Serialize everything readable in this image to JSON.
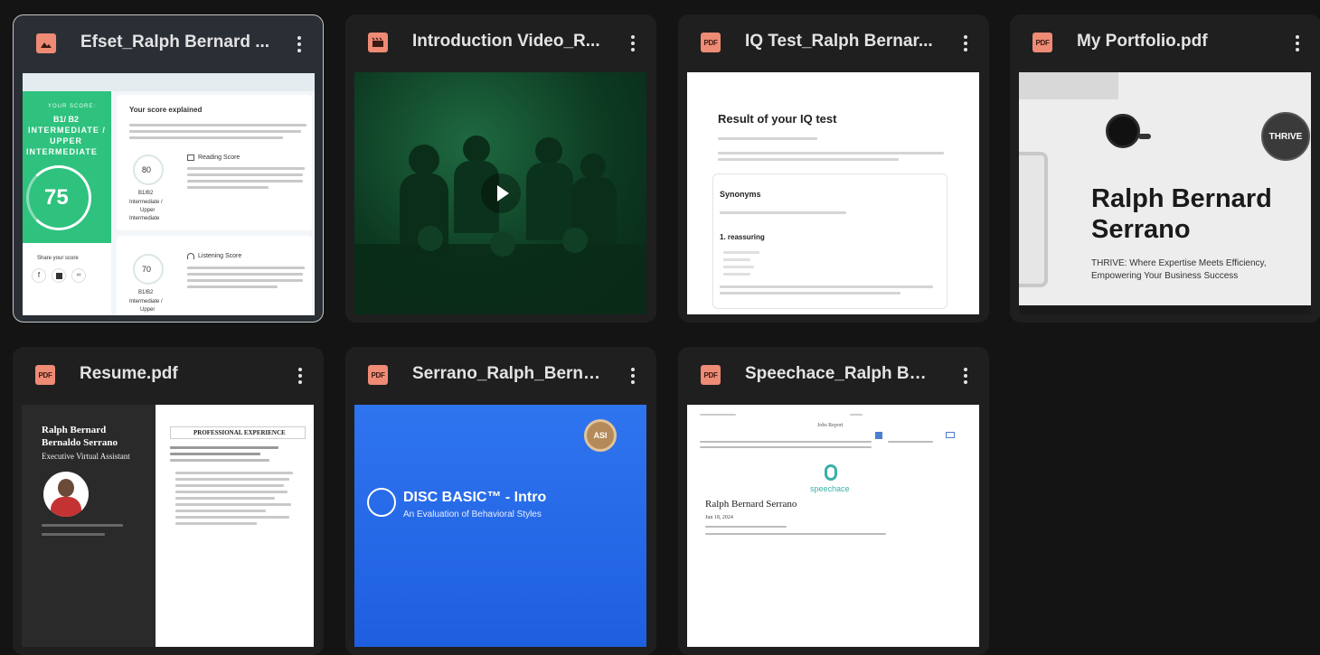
{
  "files": [
    {
      "name": "Efset_Ralph Bernard ...",
      "type": "image"
    },
    {
      "name": "Introduction Video_R...",
      "type": "video"
    },
    {
      "name": "IQ Test_Ralph Bernar...",
      "type": "pdf"
    },
    {
      "name": "My Portfolio.pdf",
      "type": "pdf"
    },
    {
      "name": "Resume.pdf",
      "type": "pdf"
    },
    {
      "name": "Serrano_Ralph_Berna...",
      "type": "pdf"
    },
    {
      "name": "Speechace_Ralph Ber...",
      "type": "pdf"
    }
  ],
  "pdf_icon_text": "PDF",
  "efset": {
    "your_score": "YOUR SCORE:",
    "level_line1": "B1/ B2",
    "level_line2": "INTERMEDIATE /",
    "level_line3": "UPPER",
    "level_line4": "INTERMEDIATE",
    "score": "75",
    "share": "Share your score",
    "explained": "Your score explained",
    "reading_title": "Reading Score",
    "reading_score": "80",
    "reading_level": "B1/B2",
    "reading_desc1": "Intermediate /",
    "reading_desc2": "Upper",
    "reading_desc3": "Intermediate",
    "listening_title": "Listening Score",
    "listening_score": "70",
    "listening_level": "B1/B2",
    "listening_desc1": "Intermediate /",
    "listening_desc2": "Upper"
  },
  "iq": {
    "title": "Result of your IQ test",
    "section": "Synonyms",
    "question": "1. reassuring"
  },
  "portfolio": {
    "name_line1": "Ralph Bernard",
    "name_line2": "Serrano",
    "tag_line1": "THRIVE: Where Expertise Meets Efficiency,",
    "tag_line2": "Empowering Your Business Success",
    "logo": "THRIVE"
  },
  "resume": {
    "name_line1": "Ralph Bernard",
    "name_line2": "Bernaldo Serrano",
    "role": "Executive Virtual Assistant",
    "section": "PROFESSIONAL EXPERIENCE"
  },
  "disc": {
    "title": "DISC BASIC™ - Intro",
    "subtitle": "An Evaluation of Behavioral Styles",
    "badge": "ASI"
  },
  "speechace": {
    "header": "Jobs Report",
    "brand": "speechace",
    "name": "Ralph Bernard Serrano",
    "date": "Jun 18, 2024"
  }
}
